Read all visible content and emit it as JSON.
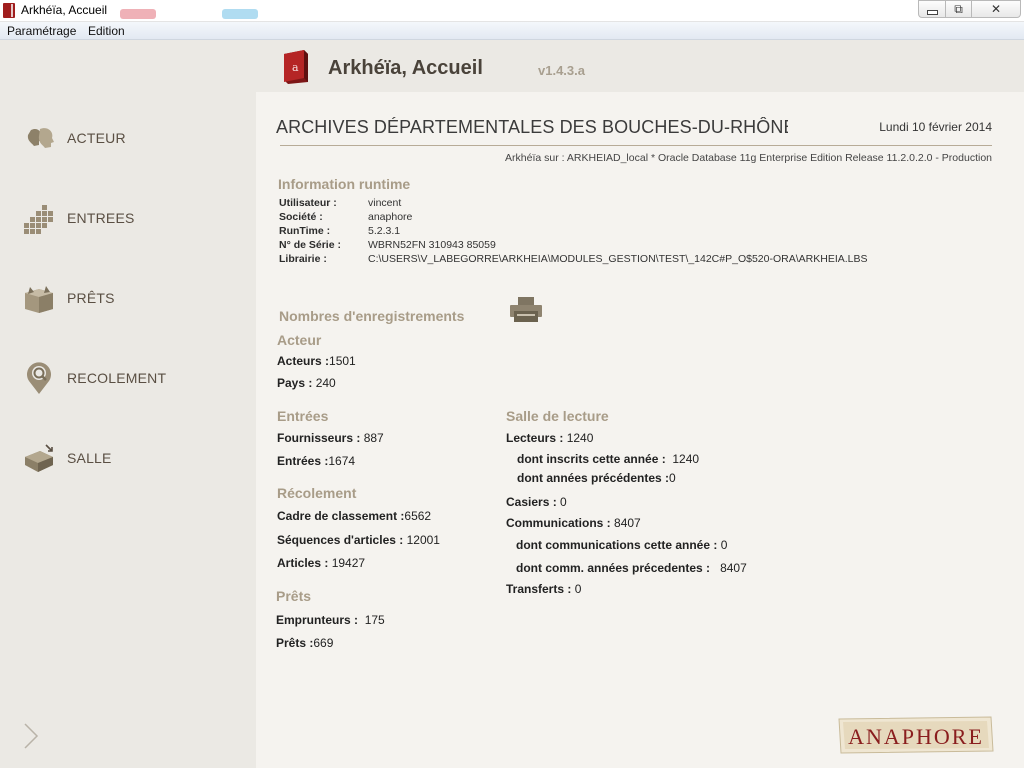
{
  "window": {
    "title": "Arkhéïa, Accueil",
    "controls": {
      "minimize": "",
      "maximize": "⧉",
      "close": "✕"
    }
  },
  "menu": [
    "Paramétrage",
    "Edition"
  ],
  "sidebar": {
    "items": [
      {
        "label": "ACTEUR",
        "icon": "actor-heads-icon"
      },
      {
        "label": "ENTREES",
        "icon": "entries-grid-icon"
      },
      {
        "label": "PRÊTS",
        "icon": "loans-box-icon"
      },
      {
        "label": "RECOLEMENT",
        "icon": "magnifier-pin-icon"
      },
      {
        "label": "SALLE",
        "icon": "reading-room-box-icon"
      }
    ],
    "collapse_icon": "chevron-right-icon"
  },
  "header": {
    "title": "Arkhéïa, Accueil",
    "version": "v1.4.3.a"
  },
  "archive": {
    "name": "ARCHIVES DÉPARTEMENTALES DES BOUCHES-DU-RHÔNE",
    "date": "Lundi 10 février 2014",
    "connection": "Arkhéïa sur : ARKHEIAD_local  * Oracle Database 11g Enterprise Edition Release 11.2.0.2.0 - Production"
  },
  "runtime": {
    "title": "Information runtime",
    "rows": [
      {
        "key": "Utilisateur :",
        "value": "vincent"
      },
      {
        "key": "Société :",
        "value": "anaphore"
      },
      {
        "key": "RunTime :",
        "value": "5.2.3.1"
      },
      {
        "key": "N° de Série :",
        "value": "WBRN52FN 310943 85059"
      },
      {
        "key": "Librairie :",
        "value": "C:\\USERS\\V_LABEGORRE\\ARKHEIA\\MODULES_GESTION\\TEST\\_142C#P_O$520-ORA\\ARKHEIA.LBS"
      }
    ]
  },
  "counts": {
    "title": "Nombres d'enregistrements",
    "print_icon": "printer-icon",
    "acteur": {
      "title": "Acteur",
      "acteurs": {
        "label": "Acteurs :",
        "value": "1501"
      },
      "pays": {
        "label": "Pays :",
        "value": "240"
      }
    },
    "entrees": {
      "title": "Entrées",
      "fournisseurs": {
        "label": "Fournisseurs :",
        "value": "887"
      },
      "entrees": {
        "label": "Entrées :",
        "value": "1674"
      }
    },
    "recolement": {
      "title": "Récolement",
      "cadre": {
        "label": "Cadre de classement :",
        "value": "6562"
      },
      "sequences": {
        "label": "Séquences d'articles :",
        "value": "12001"
      },
      "articles": {
        "label": "Articles :",
        "value": "19427"
      }
    },
    "prets": {
      "title": "Prêts",
      "emprunteurs": {
        "label": "Emprunteurs :",
        "value": "175"
      },
      "prets": {
        "label": "Prêts :",
        "value": "669"
      }
    },
    "salle": {
      "title": "Salle de lecture",
      "lecteurs": {
        "label": "Lecteurs :",
        "value": "1240"
      },
      "inscrits": {
        "label": "dont inscrits cette année :",
        "value": "1240"
      },
      "anciens": {
        "label": "dont années précédentes :",
        "value": "0"
      },
      "casiers": {
        "label": "Casiers :",
        "value": "0"
      },
      "communications": {
        "label": "Communications :",
        "value": "8407"
      },
      "comm_annee": {
        "label": "dont communications cette année :",
        "value": "0"
      },
      "comm_prec": {
        "label": "dont comm. années précedentes :",
        "value": "8407"
      },
      "transferts": {
        "label": "Transferts :",
        "value": "0"
      }
    }
  },
  "logo": {
    "text": "ANAPHORE",
    "color": "#8a1e1e"
  },
  "colors": {
    "sidebar_bg": "#ebe9e4",
    "content_bg": "#f5f3ef",
    "section_title": "#a89c88",
    "nav_label": "#5a4f43"
  }
}
